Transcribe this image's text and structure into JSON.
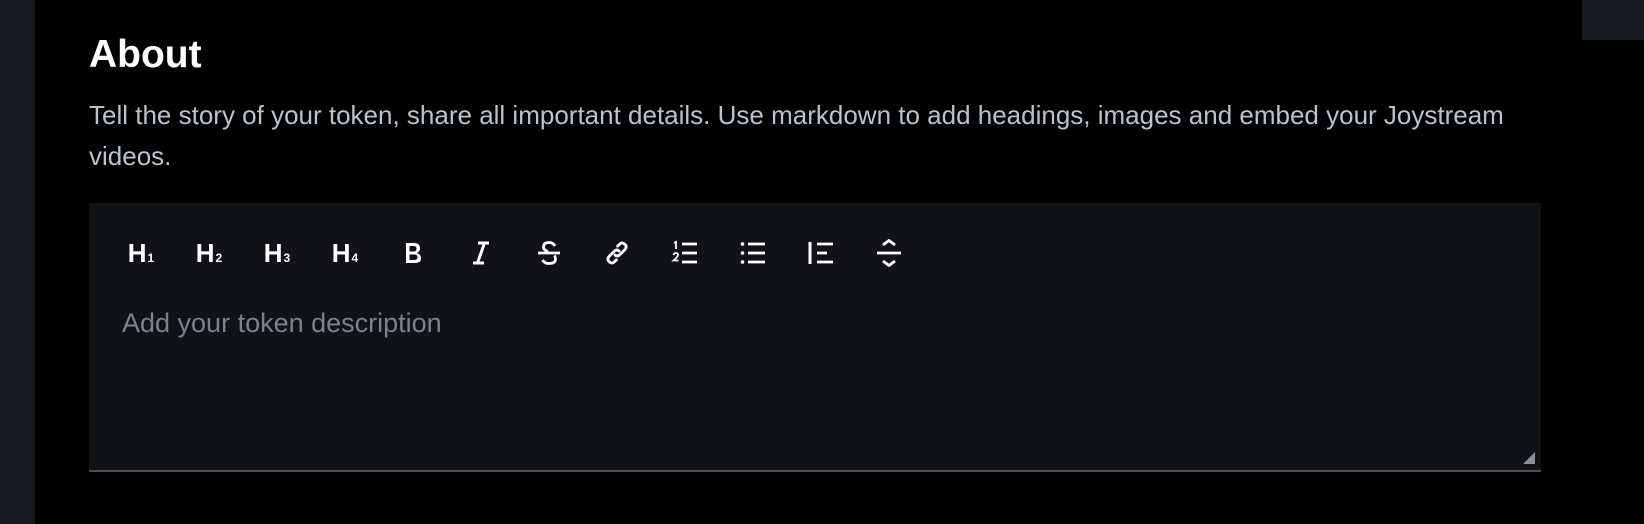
{
  "section": {
    "title": "About",
    "description": "Tell the story of your token, share all important details. Use markdown to add headings, images and embed your Joystream videos."
  },
  "editor": {
    "placeholder": "Add your token description",
    "value": ""
  },
  "toolbar": {
    "heading1": {
      "main": "H",
      "sub": "1",
      "icon": "heading-1-icon"
    },
    "heading2": {
      "main": "H",
      "sub": "2",
      "icon": "heading-2-icon"
    },
    "heading3": {
      "main": "H",
      "sub": "3",
      "icon": "heading-3-icon"
    },
    "heading4": {
      "main": "H",
      "sub": "4",
      "icon": "heading-4-icon"
    },
    "bold": {
      "icon": "bold-icon"
    },
    "italic": {
      "icon": "italic-icon"
    },
    "strikethrough": {
      "icon": "strikethrough-icon"
    },
    "link": {
      "icon": "link-icon"
    },
    "ordered_list": {
      "icon": "ordered-list-icon"
    },
    "unordered_list": {
      "icon": "unordered-list-icon"
    },
    "blockquote": {
      "icon": "blockquote-icon"
    },
    "divider": {
      "icon": "horizontal-rule-icon"
    }
  },
  "colors": {
    "background": "#000000",
    "editor_background": "#101216",
    "text_primary": "#ffffff",
    "text_secondary": "#bbc2cc",
    "placeholder": "#7b828c",
    "border": "#4a5058"
  }
}
